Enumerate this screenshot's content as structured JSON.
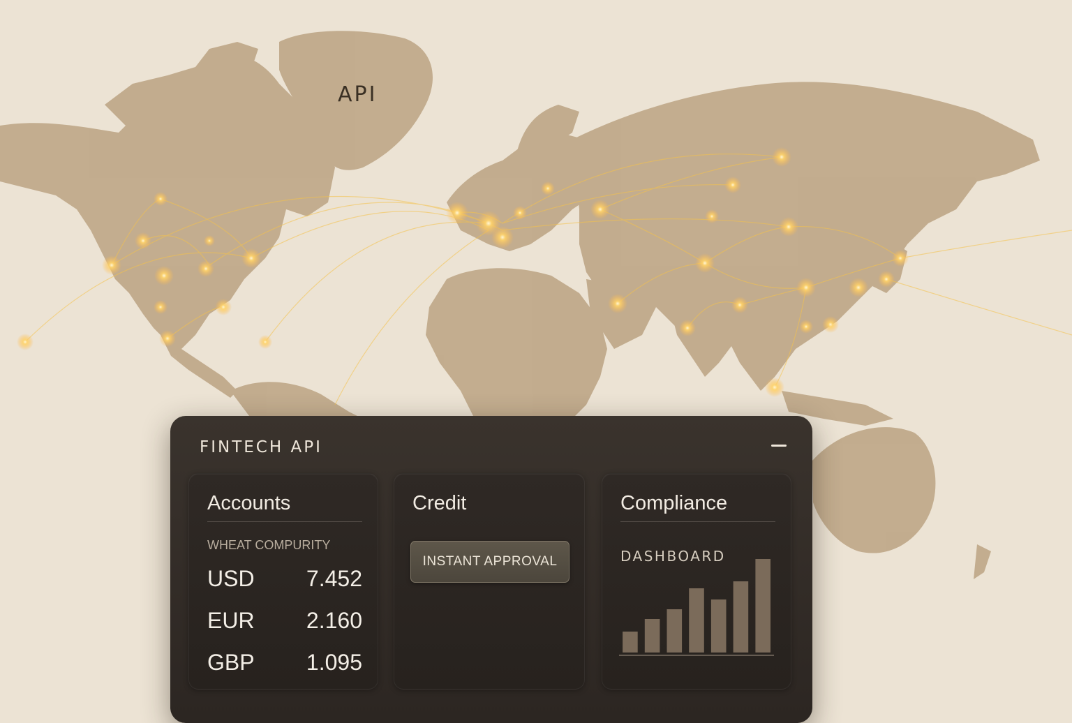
{
  "map": {
    "label": "API",
    "land_color": "#bfa889",
    "ocean_color": "#ece3d4",
    "glow_color": "#ffd36a",
    "line_color": "#f5c24a"
  },
  "panel": {
    "title": "FINTECH API",
    "minimize_icon": "minimize-icon",
    "accounts": {
      "title": "Accounts",
      "subhead": "WHEAT COMPURITY",
      "rows": [
        {
          "code": "USD",
          "value": "7.452"
        },
        {
          "code": "EUR",
          "value": "2.160"
        },
        {
          "code": "GBP",
          "value": "1.095"
        }
      ]
    },
    "credit": {
      "title": "Credit",
      "button_label": "INSTANT APPROVAL"
    },
    "compliance": {
      "title": "Compliance",
      "dashboard_label": "DASHBOARD",
      "bar_color": "#7b6b5a"
    }
  },
  "chart_data": {
    "type": "bar",
    "categories": [
      "",
      "",
      "",
      "",
      "",
      "",
      ""
    ],
    "values": [
      30,
      48,
      62,
      92,
      76,
      102,
      134
    ],
    "title": "",
    "xlabel": "",
    "ylabel": "",
    "ylim": [
      0,
      140
    ],
    "grid": false
  }
}
